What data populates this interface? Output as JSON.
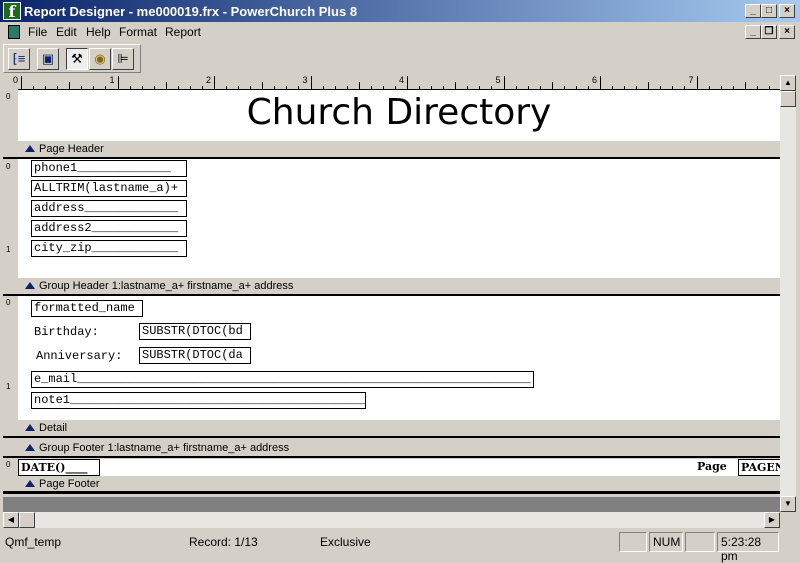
{
  "window": {
    "title": "Report Designer - me000019.frx - PowerChurch Plus 8",
    "logo": "f",
    "min": "_",
    "max": "□",
    "close": "×",
    "restore": "❐"
  },
  "menu": [
    "File",
    "Edit",
    "Help",
    "Format",
    "Report"
  ],
  "toolbar": [
    {
      "icon": "data-environment-icon"
    },
    {
      "icon": "report-controls-icon"
    },
    {
      "icon": "tools-icon"
    },
    {
      "icon": "color-palette-icon"
    },
    {
      "icon": "layout-icon"
    }
  ],
  "ruler": {
    "marks": [
      "0",
      "1",
      "2",
      "3",
      "4",
      "5",
      "6",
      "7"
    ]
  },
  "report": {
    "title": "Church Directory",
    "bands": {
      "page_header": "Page Header",
      "group_header": "Group Header 1:lastname_a+ firstname_a+ address",
      "detail": "Detail",
      "group_footer": "Group Footer 1:lastname_a+ firstname_a+ address",
      "page_footer": "Page Footer"
    },
    "page_header_fields": [
      "phone1_____________",
      "ALLTRIM(lastname_a)+",
      "address_____________",
      "address2____________",
      "city_zip____________"
    ],
    "group_fields": {
      "name": "formatted_name",
      "birthday_label": "Birthday:",
      "birthday": "SUBSTR(DTOC(bd",
      "anniversary_label": "Anniversary:",
      "anniversary": "SUBSTR(DTOC(da",
      "email": "e_mail_______________________________________________________________",
      "note": "note1_______________________________________________"
    },
    "footer": {
      "date": "DATE()____",
      "page_label": "Page",
      "page": "PAGENO"
    },
    "left_marks": {
      "zero": "0",
      "one": "1"
    }
  },
  "status": {
    "alias": "Qmf_temp",
    "record": "Record: 1/13",
    "mode": "Exclusive",
    "caps": "",
    "num": "NUM",
    "scroll": "",
    "time": "5:23:28 pm"
  }
}
